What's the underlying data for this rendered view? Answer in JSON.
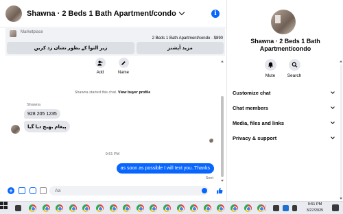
{
  "header": {
    "title": "Shawna · 2 Beds 1 Bath Apartment/condo"
  },
  "marketplace": {
    "label": "Marketplace",
    "listing": "2 Beds 1 Bath Apartment/condo · $890",
    "mark_button": "زیر التوا کے بطور نشان زد کریں",
    "more_button": "مزید آپشنز"
  },
  "quick_actions": {
    "add": "Add",
    "name": "Name"
  },
  "system": {
    "started": "Shawna started this chat.",
    "view_profile": "View buyer profile"
  },
  "messages": {
    "sender": "Shawna",
    "incoming": [
      "928 205 1235",
      "پیغام بھیج دیا گیا"
    ],
    "timestamp": "9:51 PM",
    "outgoing": "as soon as possible I will text you..Thanks",
    "status": "Sent"
  },
  "composer": {
    "placeholder": "Aa"
  },
  "panel": {
    "title": "Shawna · 2 Beds 1 Bath Apartment/condo",
    "mute": "Mute",
    "search": "Search",
    "sections": [
      "Customize chat",
      "Chat members",
      "Media, files and links",
      "Privacy & support"
    ]
  },
  "taskbar": {
    "time": "9:51 PM",
    "date": "3/27/2025",
    "browser_count": 18
  },
  "colors": {
    "accent": "#0866ff",
    "bubble_in": "#e4e6eb",
    "market_bg": "#f0f2f5"
  }
}
